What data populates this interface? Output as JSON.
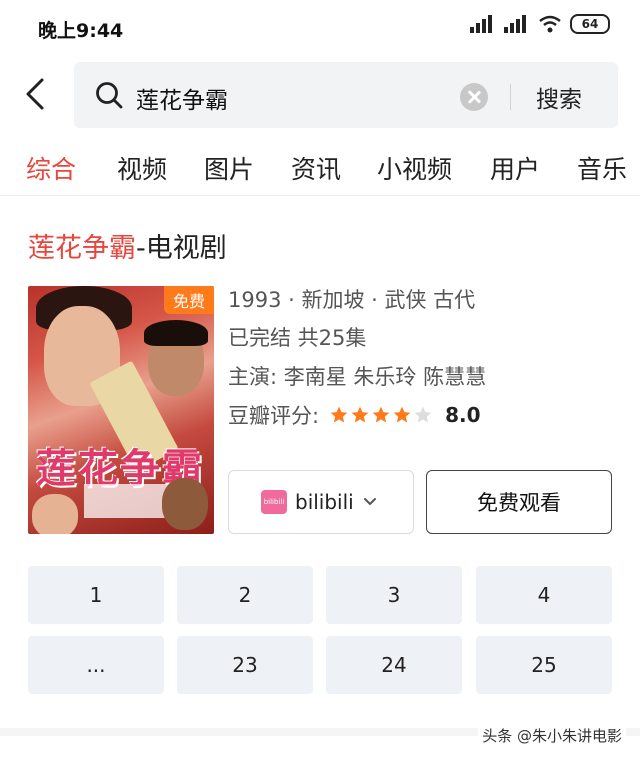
{
  "status_bar": {
    "time": "晚上9:44",
    "battery": "64"
  },
  "search": {
    "query": "莲花争霸",
    "submit_label": "搜索"
  },
  "tabs": [
    {
      "label": "综合",
      "active": true
    },
    {
      "label": "视频",
      "active": false
    },
    {
      "label": "图片",
      "active": false
    },
    {
      "label": "资讯",
      "active": false
    },
    {
      "label": "小视频",
      "active": false
    },
    {
      "label": "用户",
      "active": false
    },
    {
      "label": "音乐",
      "active": false
    }
  ],
  "result": {
    "title_highlight": "莲花争霸",
    "title_suffix": "-电视剧",
    "poster_badge": "免费",
    "poster_title": "莲花争霸",
    "info_line": "1993 · 新加坡 · 武侠 古代",
    "status_line": "已完结 共25集",
    "cast_line": "主演: 李南星 朱乐玲 陈慧慧",
    "rating_label": "豆瓣评分:",
    "rating_score": "8.0",
    "rating_stars": 4,
    "source_label": "bilibili",
    "source_logo": "bilibili",
    "watch_label": "免费观看"
  },
  "episodes": [
    "1",
    "2",
    "3",
    "4",
    "...",
    "23",
    "24",
    "25"
  ],
  "watermark": "头条 @朱小朱讲电影",
  "colors": {
    "accent": "#e8453c",
    "star": "#ff7a1a",
    "badge": "#ff7a1a"
  }
}
